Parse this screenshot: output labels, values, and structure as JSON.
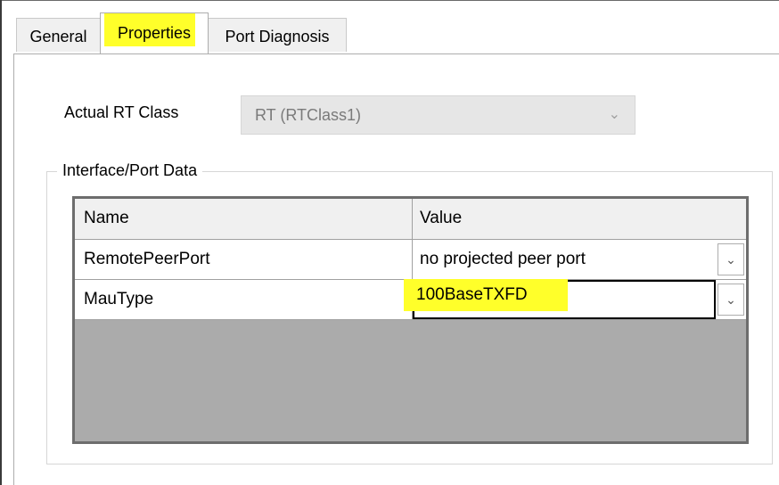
{
  "tabs": {
    "general": "General",
    "properties": "Properties",
    "port_diagnosis": "Port Diagnosis"
  },
  "actual_rt_class": {
    "label": "Actual RT Class",
    "value": "RT (RTClass1)"
  },
  "interface_port_data": {
    "legend": "Interface/Port Data",
    "columns": [
      "Name",
      "Value"
    ],
    "rows": [
      {
        "name": "RemotePeerPort",
        "value": "no projected peer port"
      },
      {
        "name": "MauType",
        "value": "100BaseTXFD"
      }
    ]
  },
  "colors": {
    "highlight": "#ffff2a",
    "grid_background": "#ababab",
    "tab_background": "#f0f0f0"
  },
  "icons": {
    "dropdown": "chevron-down-icon"
  }
}
